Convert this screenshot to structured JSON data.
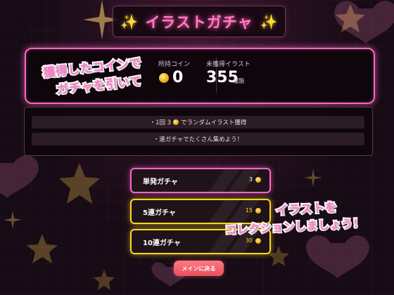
{
  "title": {
    "text": "イラストガチャ",
    "left_icon": "sparkles-icon",
    "right_icon": "sparkles-icon"
  },
  "stats": {
    "coins_label": "所持コイン",
    "coins_value": "0",
    "unowned_label": "未獲得イラスト",
    "unowned_value": "355",
    "unowned_unit": "種類"
  },
  "overlay_left": {
    "line1": "獲得したコインで",
    "line2": "ガチャを引いて"
  },
  "info": {
    "row1_prefix": "・1回 3",
    "row1_suffix": " でランダムイラスト獲得",
    "row2": "・連ガチャでたくさん集めよう！"
  },
  "gacha_buttons": [
    {
      "label": "単発ガチャ",
      "cost": "3"
    },
    {
      "label": "5連ガチャ",
      "cost": "15"
    },
    {
      "label": "10連ガチャ",
      "cost": "30"
    }
  ],
  "overlay_right": {
    "line1": "イラストを",
    "line2": "コレクションしましょう！"
  },
  "back_button": {
    "label": "メインに戻る"
  },
  "colors": {
    "neon_pink": "#ff66c4",
    "neon_yellow": "#ffd61f",
    "title_pink": "#ff7cc5",
    "back_button": "#e6505c"
  }
}
